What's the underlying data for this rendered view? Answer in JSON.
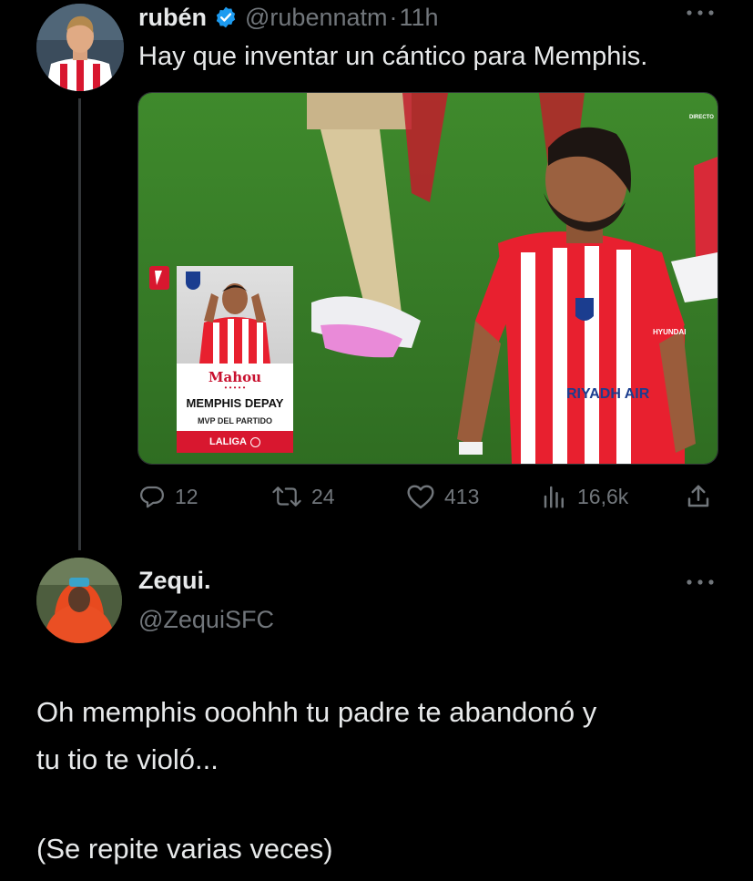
{
  "tweet1": {
    "display_name": "rubén",
    "handle": "@rubennatm",
    "separator": "·",
    "time": "11h",
    "text": "Hay que inventar un cántico para Memphis.",
    "media": {
      "corner_label": "DIRECTO",
      "card": {
        "brand": "Mahou",
        "player": "MEMPHIS DEPAY",
        "award": "MVP DEL PARTIDO",
        "league": "LALIGA"
      },
      "shirt_sponsor": "RIYADH AIR",
      "shirt_partner": "HYUNDAI"
    },
    "actions": {
      "replies": "12",
      "reposts": "24",
      "likes": "413",
      "views": "16,6k"
    }
  },
  "tweet2": {
    "display_name": "Zequi.",
    "handle": "@ZequiSFC",
    "text_line1": "Oh memphis ooohhh tu padre te abandonó y",
    "text_line2": "tu tio te violó...",
    "text_line3": "(Se repite varias veces)"
  },
  "colors": {
    "background": "#000000",
    "text": "#e7e9ea",
    "muted": "#71767b",
    "verified": "#1d9bf0",
    "atletico_red": "#d8172f"
  },
  "icons": [
    "verified-badge-icon",
    "more-icon",
    "reply-icon",
    "repost-icon",
    "like-icon",
    "views-icon",
    "share-icon"
  ]
}
